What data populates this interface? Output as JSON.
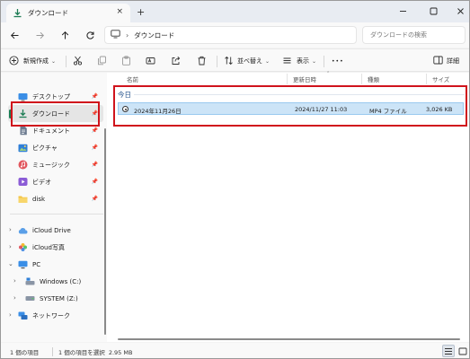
{
  "window": {
    "tab_title": "ダウンロード",
    "new_tab": "+",
    "tab_close": "×",
    "controls": {
      "minimize": "−",
      "maximize": "☐",
      "close": "✕"
    }
  },
  "address_bar": {
    "monitor_icon": "monitor-icon",
    "separator": "›",
    "path": "ダウンロード",
    "search_placeholder": "ダウンロードの検索"
  },
  "command_bar": {
    "new_label": "新規作成",
    "sort_label": "並べ替え",
    "view_label": "表示",
    "more_label": "•••",
    "details_label": "詳細"
  },
  "sidebar": {
    "pinned": [
      {
        "label": "デスクトップ",
        "icon": "desktop-icon"
      },
      {
        "label": "ダウンロード",
        "icon": "download-icon"
      },
      {
        "label": "ドキュメント",
        "icon": "document-icon"
      },
      {
        "label": "ピクチャ",
        "icon": "pictures-icon"
      },
      {
        "label": "ミュージック",
        "icon": "music-icon"
      },
      {
        "label": "ビデオ",
        "icon": "video-icon"
      },
      {
        "label": "disk",
        "icon": "folder-icon"
      }
    ],
    "tree": [
      {
        "label": "iCloud Drive",
        "icon": "icloud-icon"
      },
      {
        "label": "iCloud写真",
        "icon": "photos-icon"
      },
      {
        "label": "PC",
        "icon": "pc-icon"
      },
      {
        "label": "Windows (C:)",
        "icon": "drive-icon"
      },
      {
        "label": "SYSTEM (Z:)",
        "icon": "drive-icon"
      },
      {
        "label": "ネットワーク",
        "icon": "network-icon"
      }
    ]
  },
  "columns": {
    "name": "名前",
    "date": "更新日時",
    "type": "種類",
    "size": "サイズ"
  },
  "group": {
    "label": "今日"
  },
  "files": [
    {
      "name": "2024年11月26日",
      "date": "2024/11/27 11:03",
      "type": "MP4 ファイル",
      "size": "3,026 KB"
    }
  ],
  "status": {
    "count": "1 個の項目",
    "selection": "1 個の項目を選択  2.95 MB"
  },
  "colors": {
    "highlight": "#d0131c",
    "selection_bg": "#cce4f7",
    "accent_green": "#1c7c54"
  }
}
